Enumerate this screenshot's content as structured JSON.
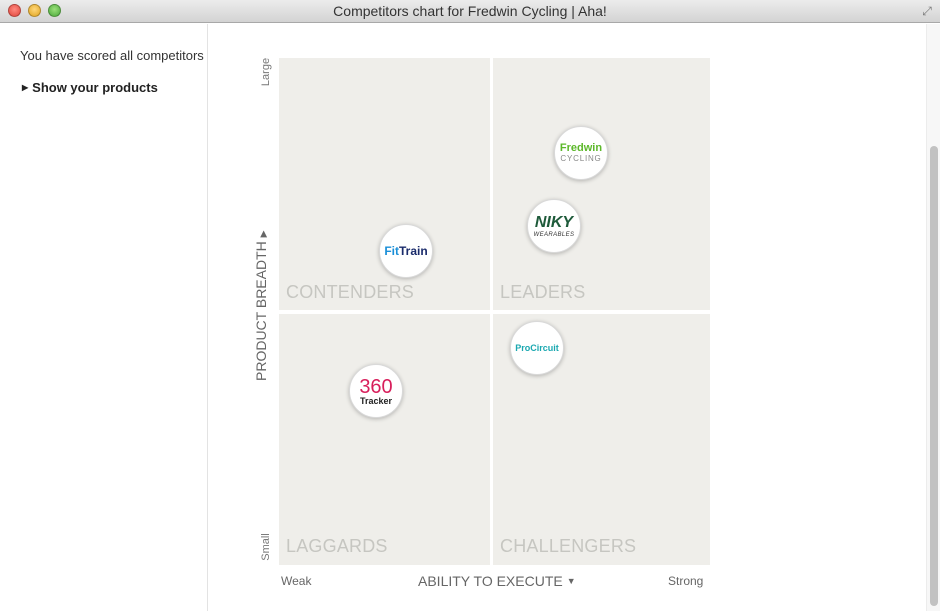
{
  "window": {
    "title": "Competitors chart for Fredwin Cycling | Aha!"
  },
  "sidebar": {
    "status_text": "You have scored all competitors",
    "show_products_label": "Show your products"
  },
  "chart": {
    "quadrants": {
      "contenders": "CONTENDERS",
      "leaders": "LEADERS",
      "laggards": "LAGGARDS",
      "challengers": "CHALLENGERS"
    },
    "y_axis": {
      "label": "PRODUCT BREADTH",
      "max_label": "Large",
      "min_label": "Small"
    },
    "x_axis": {
      "label": "ABILITY TO EXECUTE",
      "min_label": "Weak",
      "max_label": "Strong"
    },
    "competitors": [
      {
        "id": "fredwin",
        "line1": "Fredwin",
        "line2": "CYCLING"
      },
      {
        "id": "niky",
        "line1": "NIKY",
        "line2": "WEARABLES"
      },
      {
        "id": "fittrain",
        "part1": "Fit",
        "part2": "Train"
      },
      {
        "id": "procircuit",
        "line1": "ProCircuit"
      },
      {
        "id": "360tracker",
        "line1": "360",
        "line2": "Tracker"
      }
    ]
  }
}
